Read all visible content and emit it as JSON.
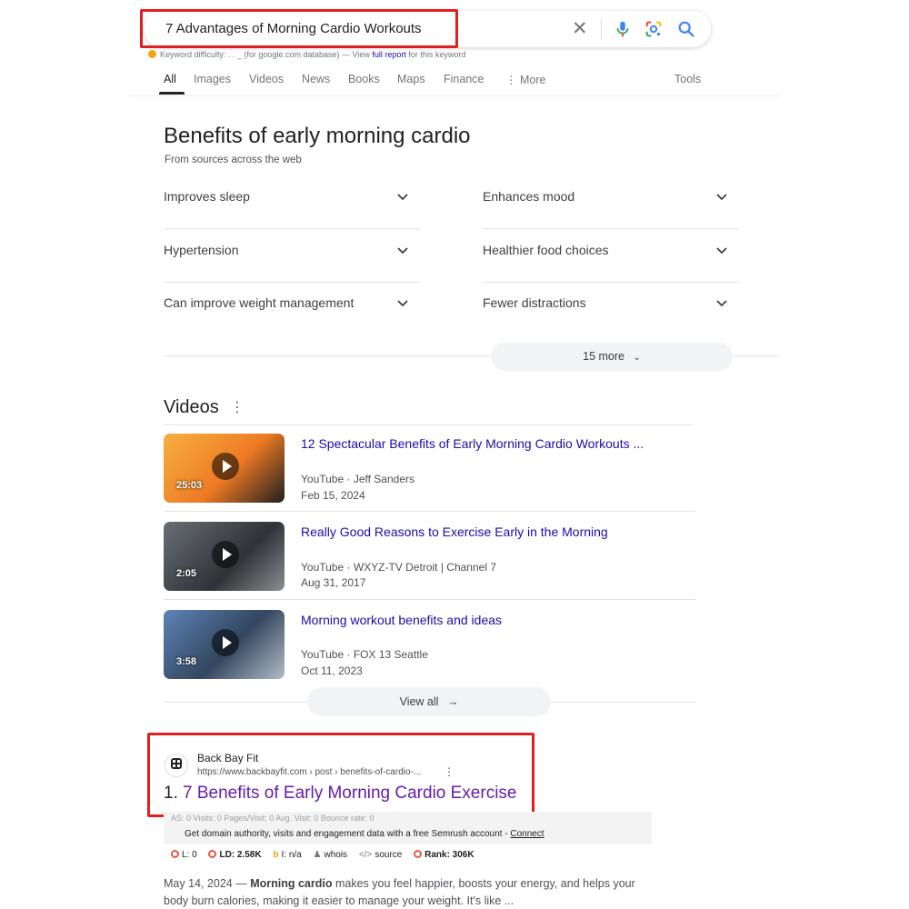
{
  "search": {
    "query": "7 Advantages of Morning Cardio Workouts",
    "clear_icon": "close-icon",
    "mic_icon": "microphone-icon",
    "lens_icon": "google-lens-icon",
    "search_icon": "search-icon"
  },
  "keyword_difficulty": {
    "label": "Keyword difficulty:",
    "value": ". . _",
    "source_note": "(for google.com database) — View",
    "link_text": "full report",
    "tail": "for this keyword"
  },
  "tabs": [
    {
      "label": "All",
      "active": true
    },
    {
      "label": "Images"
    },
    {
      "label": "Videos"
    },
    {
      "label": "News"
    },
    {
      "label": "Books"
    },
    {
      "label": "Maps"
    },
    {
      "label": "Finance"
    },
    {
      "label": "More"
    },
    {
      "label": "Tools"
    }
  ],
  "benefits": {
    "title": "Benefits of early morning cardio",
    "subtitle": "From sources across the web",
    "items": [
      "Improves sleep",
      "Enhances mood",
      "Hypertension",
      "Healthier food choices",
      "Can improve weight management",
      "Fewer distractions"
    ],
    "more_label": "15 more"
  },
  "videos": {
    "title": "Videos",
    "items": [
      {
        "title": "12 Spectacular Benefits of Early Morning Cardio Workouts ...",
        "source": "YouTube · Jeff Sanders",
        "date": "Feb 15, 2024",
        "duration": "25:03",
        "thumb_color": "#f08a2a"
      },
      {
        "title": "Really Good Reasons to Exercise Early in the Morning",
        "source": "YouTube · WXYZ-TV Detroit | Channel 7",
        "date": "Aug 31, 2017",
        "duration": "2:05",
        "thumb_color": "#4a4f55"
      },
      {
        "title": "Morning workout benefits and ideas",
        "source": "YouTube · FOX 13 Seattle",
        "date": "Oct 11, 2023",
        "duration": "3:58",
        "thumb_color": "#3d5f8a"
      }
    ],
    "view_all_label": "View all"
  },
  "result": {
    "site_name": "Back Bay Fit",
    "url": "https://www.backbayfit.com › post › benefits-of-cardio-...",
    "number": "1.",
    "title": "7 Benefits of Early Morning Cardio Exercise",
    "seo_row1": "AS: 0          Visits: 0     Pages/Visit: 0     Avg. Visit: 0     Bounce rate: 0",
    "seo_row2_prefix": "Get domain authority, visits and engagement data with a free Semrush account - ",
    "seo_row2_link": "Connect",
    "metrics": [
      {
        "label": "L: 0"
      },
      {
        "label": "LD: 2.58K"
      },
      {
        "label": "I: n/a"
      },
      {
        "label": "whois"
      },
      {
        "label": "source"
      },
      {
        "label": "Rank: 306K"
      }
    ],
    "snippet_date": "May 14, 2024 — ",
    "snippet_bold": "Morning cardio",
    "snippet_rest": " makes you feel happier, boosts your energy, and helps your body burn calories, making it easier to manage your weight. It's like ..."
  },
  "colors": {
    "highlight": "#e02020",
    "link": "#1a0dab",
    "visited": "#681da8"
  }
}
